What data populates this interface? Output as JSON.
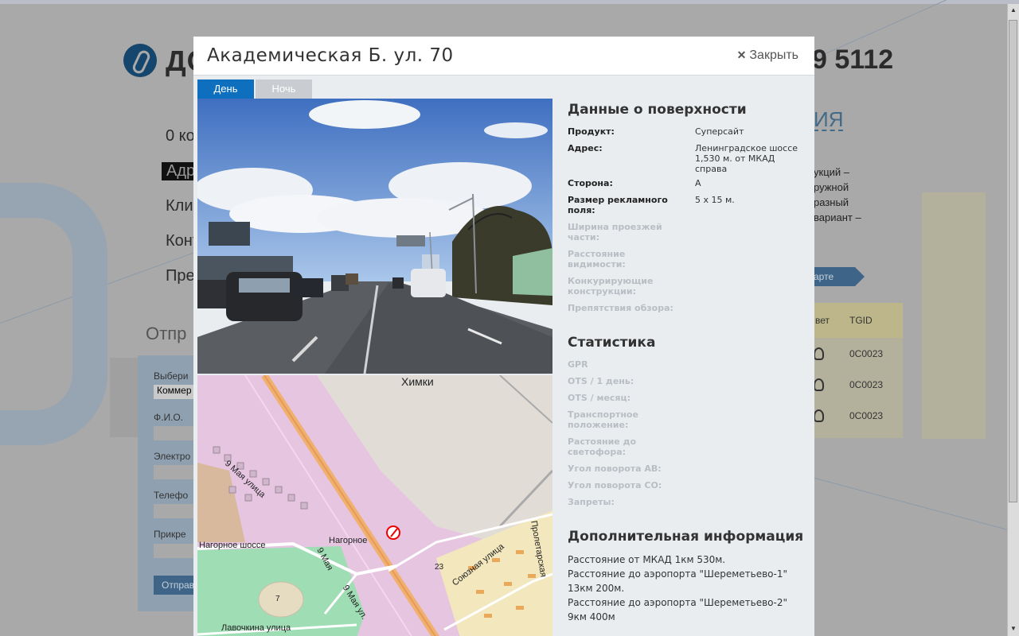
{
  "background": {
    "brand_text": "ДО",
    "phone_text": "9 5112",
    "menu": [
      "0 ко",
      "Адр",
      "Кли",
      "Конт",
      "Пре"
    ],
    "right_heading": "ИЯ",
    "right_para": [
      "укций –",
      "ружной",
      "разный",
      "вариант –"
    ],
    "map_pill": "арте",
    "table_headers": [
      "вет",
      "TGID"
    ],
    "table_rows": [
      "0C0023",
      "0C0023",
      "0C0023"
    ],
    "form_title": "Отпр",
    "form_labels": [
      "Выбери",
      "Ф.И.О.",
      "Электро",
      "Телефо",
      "Прикре"
    ],
    "form_select": "Коммер",
    "form_button": "Отправ",
    "big_letters": [
      "O",
      "T"
    ]
  },
  "modal": {
    "title": "Академическая Б. ул. 70",
    "close_label": "Закрыть",
    "tabs": [
      {
        "label": "День",
        "active": true
      },
      {
        "label": "Ночь",
        "active": false
      }
    ],
    "map_labels": {
      "city": "Химки",
      "street1": "9 Мая улица",
      "street2": "Нагорное шоссе",
      "street3": "Нагорное",
      "street4": "9 Мая",
      "street5": "9 Мая ул.",
      "street6": "Союзная улица",
      "street7": "Лавочкина улица",
      "street8": "Пролетарская",
      "house": "23",
      "house2": "7"
    },
    "surface": {
      "title": "Данные о поверхности",
      "rows": [
        {
          "label": "Продукт:",
          "value": "Суперсайт",
          "muted": false
        },
        {
          "label": "Адрес:",
          "value": "Ленинградское шоссе 1,530 м. от МКАД справа",
          "muted": false
        },
        {
          "label": "Сторона:",
          "value": "А",
          "muted": false
        },
        {
          "label": "Размер рекламного поля:",
          "value": "5 х 15 м.",
          "muted": false
        },
        {
          "label": "Ширина проезжей части:",
          "value": "",
          "muted": true
        },
        {
          "label": "Расстояние видимости:",
          "value": "",
          "muted": true
        },
        {
          "label": "Конкурирующие конструкции:",
          "value": "",
          "muted": true
        },
        {
          "label": "Препятствия обзора:",
          "value": "",
          "muted": true
        }
      ]
    },
    "stats": {
      "title": "Статистика",
      "rows": [
        "GPR",
        "OTS / 1 день:",
        "OTS / месяц:",
        "Транспортное положение:",
        "Растояние до светофора:",
        "Угол поворота АВ:",
        "Угол поворота СО:",
        "Запреты:"
      ]
    },
    "extra": {
      "title": "Дополнительная информация",
      "lines": [
        "Расстояние от МКАД 1км 530м.",
        "Расстояние до аэропорта \"Шереметьево-1\"",
        "13км 200м.",
        "Расстояние до аэропорта \"Шереметьево-2\"",
        "9км 400м"
      ]
    }
  },
  "colors": {
    "overlay": "#a9a9a9",
    "tab_active": "#0f6fbf",
    "tab_inactive": "#c9cdd1",
    "modal_bg": "#e9edf0",
    "map_pink": "#e6c5e1",
    "map_green": "#9fddb5",
    "map_road": "#f0b070"
  }
}
